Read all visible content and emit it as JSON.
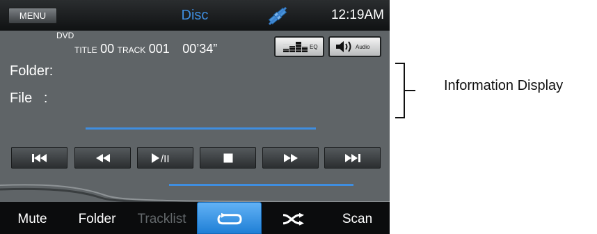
{
  "topbar": {
    "menu_label": "MENU",
    "source_title": "Disc",
    "satellite_icon": "satellite-icon",
    "clock": "12:19AM"
  },
  "info": {
    "disc_type": "DVD",
    "title_label": "TITLE",
    "title_number": "00",
    "track_label": "TRACK",
    "track_number": "001",
    "elapsed_time": "00’34”",
    "folder_label": "Folder:",
    "file_label": "File   :"
  },
  "buttons": {
    "eq_label": "EQ",
    "eq_icon": "eq-bars-icon",
    "audio_label": "Audio",
    "audio_icon": "speaker-icon"
  },
  "transport": [
    {
      "name": "skip-back",
      "icon": "skip-previous-icon"
    },
    {
      "name": "rewind",
      "icon": "rewind-icon"
    },
    {
      "name": "play-pause",
      "icon": "play-pause-icon",
      "label": "/II"
    },
    {
      "name": "stop",
      "icon": "stop-icon"
    },
    {
      "name": "fast-forward",
      "icon": "fast-forward-icon"
    },
    {
      "name": "skip-next",
      "icon": "skip-next-icon"
    }
  ],
  "bottom_bar": {
    "mute": "Mute",
    "folder": "Folder",
    "tracklist": "Tracklist",
    "repeat_icon": "repeat-icon",
    "shuffle_icon": "shuffle-icon",
    "scan": "Scan"
  },
  "callout": {
    "label": "Information Display"
  },
  "colors": {
    "accent_blue": "#3f8ee0",
    "screen_gray": "#5f6467",
    "bar_black": "#0b0c0d"
  }
}
